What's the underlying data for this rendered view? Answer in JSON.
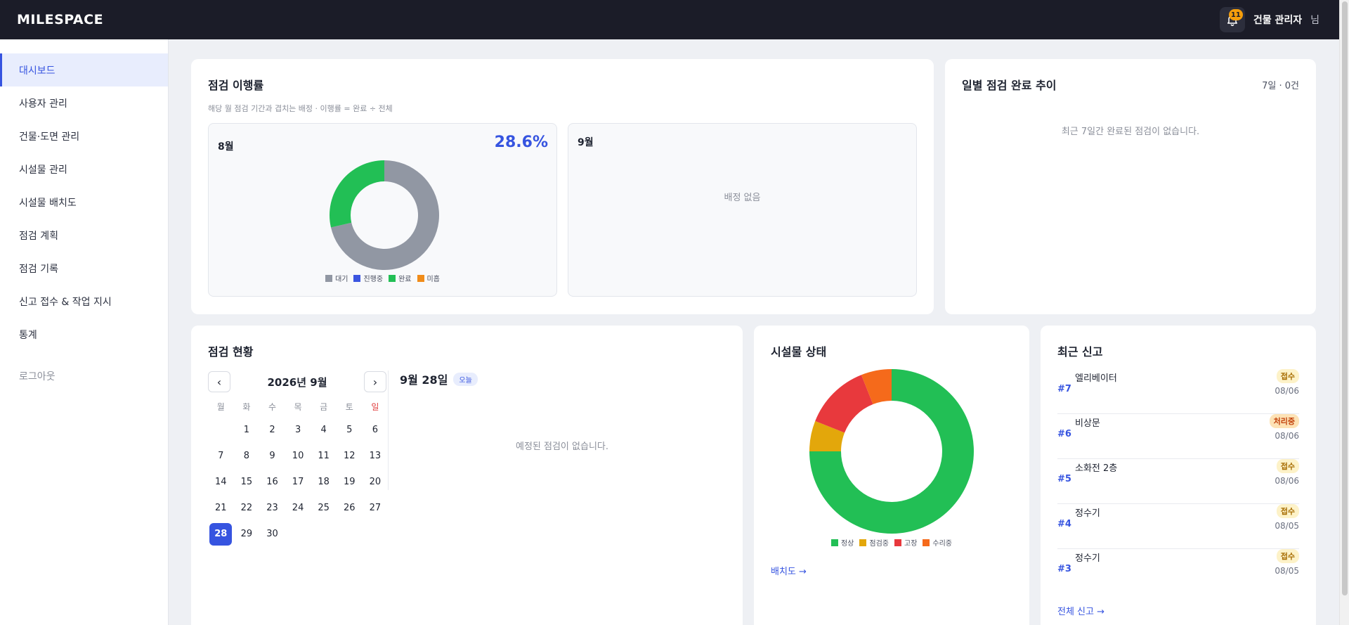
{
  "app": {
    "brand": "MILESPACE"
  },
  "header": {
    "notification_count": "11",
    "user_name": "건물 관리자",
    "user_suffix": "님"
  },
  "sidebar": {
    "items": [
      {
        "label": "대시보드",
        "active": true
      },
      {
        "label": "사용자 관리"
      },
      {
        "label": "건물·도면 관리"
      },
      {
        "label": "시설물 관리"
      },
      {
        "label": "시설물 배치도"
      },
      {
        "label": "점검 계획"
      },
      {
        "label": "점검 기록"
      },
      {
        "label": "신고 접수 & 작업 지시"
      },
      {
        "label": "통계"
      }
    ],
    "logout": "로그아웃"
  },
  "inspection_rate": {
    "title": "점검 이행률",
    "subtitle": "해당 월 점검 기간과 겹치는 배정 · 이행률 = 완료 ÷ 전체",
    "aug": {
      "title": "8월",
      "percent": "28.6%"
    },
    "sep": {
      "title": "9월",
      "empty": "배정 없음"
    },
    "legend": [
      "대기",
      "진행중",
      "완료",
      "미흡"
    ]
  },
  "daily_trend": {
    "title": "일별 점검 완료 추이",
    "meta": "7일 · 0건",
    "empty": "최근 7일간 완료된 점검이 없습니다."
  },
  "inspection_status": {
    "title": "점검 현황",
    "calendar": {
      "month_label": "2026년 9월",
      "prev": "‹",
      "next": "›",
      "weekdays": [
        "월",
        "화",
        "수",
        "목",
        "금",
        "토",
        "일"
      ],
      "start_offset": 1,
      "days_in_month": 30,
      "selected_day": 28
    },
    "day_title": "9월 28일",
    "today_label": "오늘",
    "empty": "예정된 점검이 없습니다."
  },
  "facility_status": {
    "title": "시설물 상태",
    "legend": [
      "정상",
      "점검중",
      "고장",
      "수리중"
    ],
    "link": "배치도 →"
  },
  "recent_reports": {
    "title": "최근 신고",
    "items": [
      {
        "num": "#7",
        "title": "엘리베이터",
        "status": "접수",
        "date": "08/06"
      },
      {
        "num": "#6",
        "title": "비상문",
        "status": "처리중",
        "date": "08/06"
      },
      {
        "num": "#5",
        "title": "소화전 2층",
        "status": "접수",
        "date": "08/06"
      },
      {
        "num": "#4",
        "title": "정수기",
        "status": "접수",
        "date": "08/05"
      },
      {
        "num": "#3",
        "title": "정수기",
        "status": "접수",
        "date": "08/05"
      }
    ],
    "link": "전체 신고 →"
  },
  "chart_data": [
    {
      "type": "pie",
      "donut": true,
      "title": "8월",
      "categories": [
        "대기",
        "진행중",
        "완료",
        "미흡"
      ],
      "values": [
        71.4,
        0,
        28.6,
        0
      ],
      "colors": [
        "#9197a3",
        "#3b55e0",
        "#22bf55",
        "#f08c1a"
      ]
    },
    {
      "type": "pie",
      "donut": true,
      "title": "시설물 상태",
      "categories": [
        "정상",
        "점검중",
        "고장",
        "수리중"
      ],
      "values": [
        75,
        6,
        13,
        6
      ],
      "colors": [
        "#22bf55",
        "#e3a70b",
        "#e8393d",
        "#f56a1b"
      ]
    }
  ]
}
